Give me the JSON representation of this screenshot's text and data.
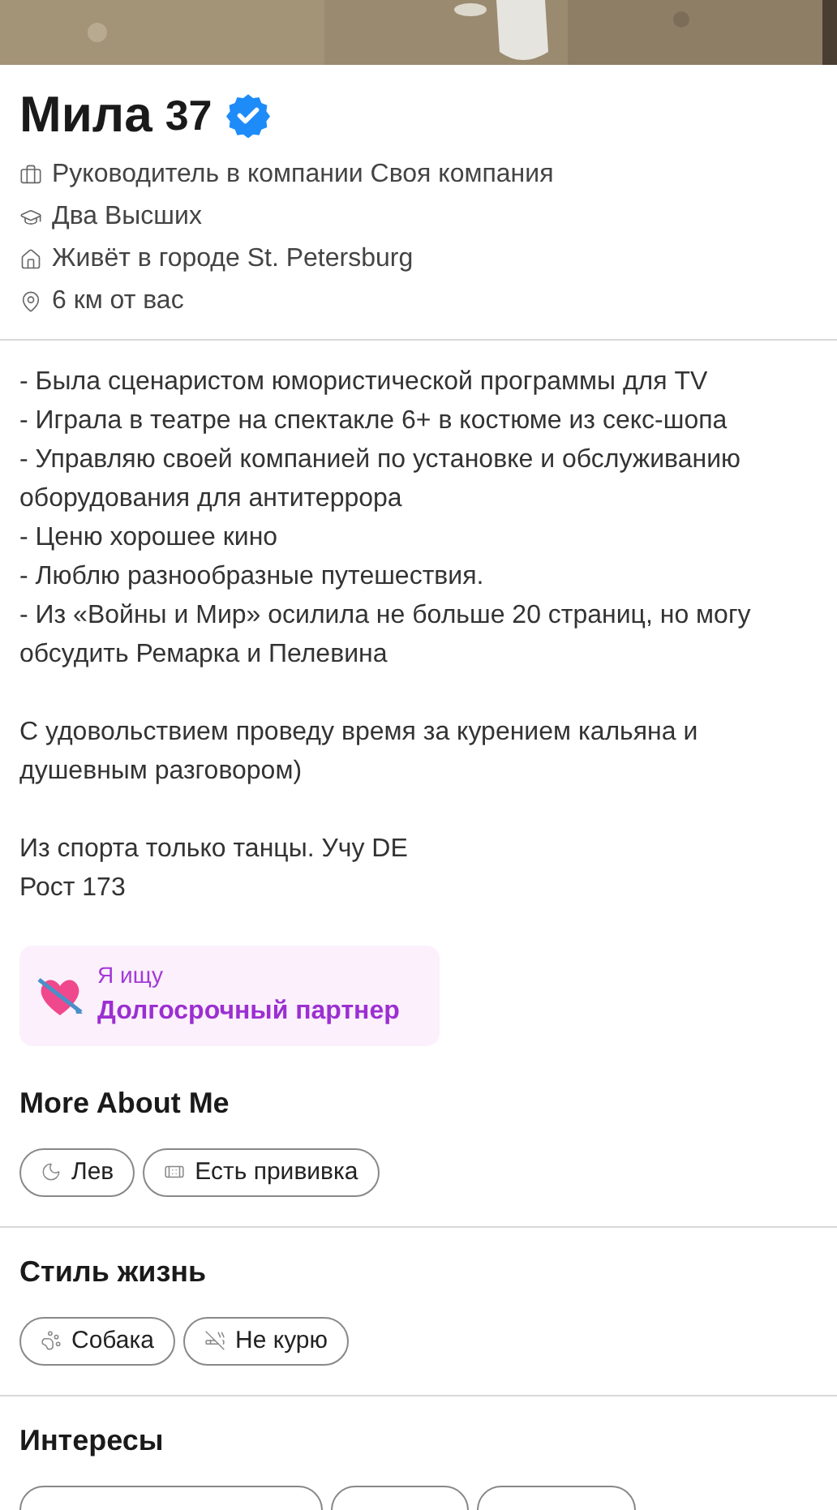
{
  "profile": {
    "name": "Мила",
    "age": "37",
    "verified": true,
    "details": [
      "Руководитель в компании Своя компания",
      "Два Высших",
      "Живёт в городе St. Petersburg",
      "6 км от вас"
    ]
  },
  "bio": [
    {
      "lines": [
        "- Была сценаристом юмористической программы для TV",
        "- Играла в театре на спектакле 6+ в костюме из секс-шопа",
        "- Управляю своей компанией по установке и обслуживанию оборудования для антитеррора",
        "- Ценю хорошее кино",
        "- Люблю разнообразные путешествия.",
        "- Из «Войны и Мир» осилила не больше 20 страниц, но могу обсудить Ремарка и Пелевина"
      ]
    },
    {
      "lines": [
        "С удовольствием проведу время за курением кальяна и душевным разговором)"
      ]
    },
    {
      "lines": [
        "Из спорта только танцы. Учу DE",
        "Рост 173"
      ]
    }
  ],
  "looking_for": {
    "label": "Я ищу",
    "value": "Долгосрочный партнер"
  },
  "sections": [
    {
      "title": "More About Me",
      "chips": [
        "Лев",
        "Есть прививка"
      ]
    },
    {
      "title": "Стиль жизнь",
      "chips": [
        "Собака",
        "Не курю"
      ]
    },
    {
      "title": "Интересы",
      "chips_cut_off": true
    }
  ]
}
